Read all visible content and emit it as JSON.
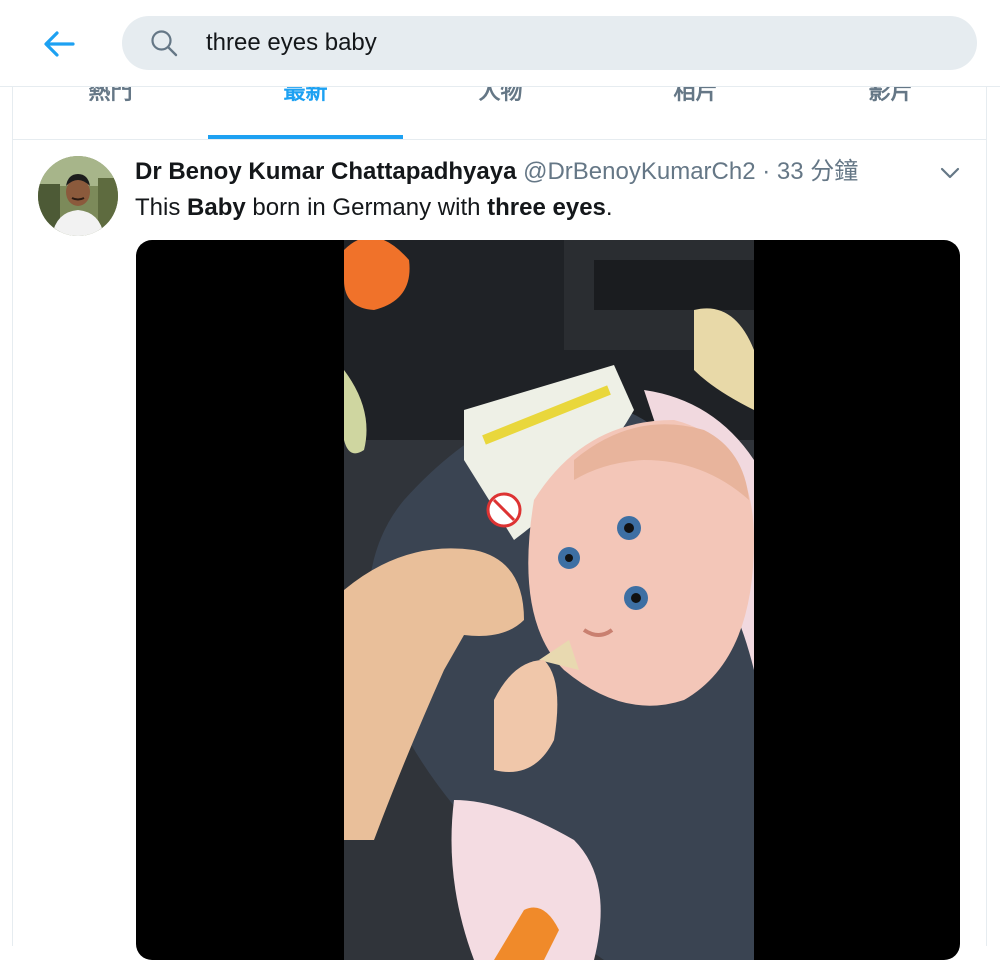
{
  "search": {
    "query": "three eyes baby"
  },
  "tabs": [
    {
      "label": "熱門"
    },
    {
      "label": "最新"
    },
    {
      "label": "人物"
    },
    {
      "label": "相片"
    },
    {
      "label": "影片"
    }
  ],
  "active_tab": "最新",
  "tweet": {
    "display_name": "Dr Benoy Kumar Chattapadhyaya",
    "handle": "@DrBenoyKumarCh2",
    "separator": "·",
    "time": "33 分鐘",
    "text_parts": {
      "t1": "This ",
      "b1": "Baby",
      "t2": " born in Germany with ",
      "b2": "three eyes",
      "t3": "."
    }
  },
  "colors": {
    "accent": "#1da1f2",
    "secondary_text": "#657786",
    "search_bg": "#e6ecf0"
  }
}
